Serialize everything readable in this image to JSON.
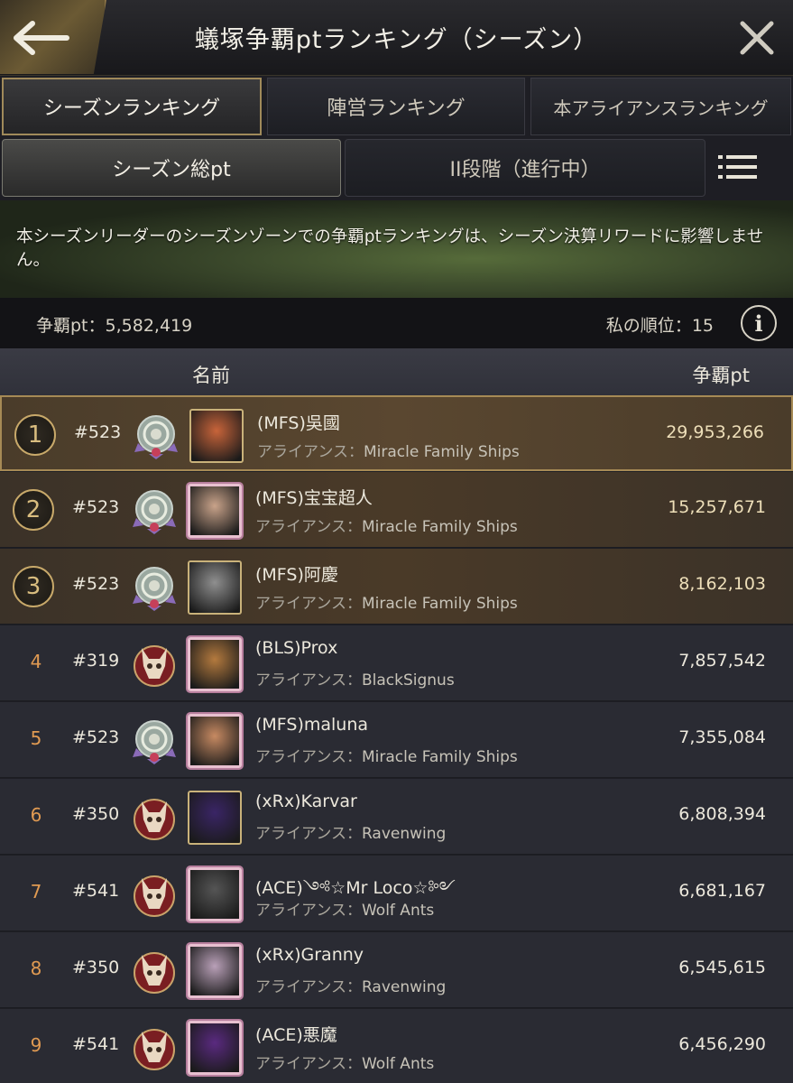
{
  "header": {
    "title": "蟻塚争覇ptランキング（シーズン）",
    "back_icon": "arrow-left-icon",
    "close_icon": "close-icon"
  },
  "tabs_primary": [
    {
      "label": "シーズンランキング",
      "active": true
    },
    {
      "label": "陣営ランキング",
      "active": false
    },
    {
      "label": "本アライアンスランキング",
      "active": false
    }
  ],
  "tabs_secondary": [
    {
      "label": "シーズン総pt",
      "active": true
    },
    {
      "label": "II段階（進行中）",
      "active": false
    }
  ],
  "menu_icon": "list-menu-icon",
  "banner": {
    "text": "本シーズンリーダーのシーズンゾーンでの争覇ptランキングは、シーズン決算リワードに影響しません。"
  },
  "stats": {
    "points_label": "争覇pt：",
    "points_value": "5,582,419",
    "rank_label": "私の順位：",
    "rank_value": "15"
  },
  "columns": {
    "name": "名前",
    "points": "争覇pt"
  },
  "alliance_label": "アライアンス：",
  "rows": [
    {
      "rank": "1",
      "server": "#523",
      "name": "(MFS)吳國",
      "alliance": "Miracle Family Ships",
      "points": "29,953,266",
      "emblem": "spiral-flower-emblem",
      "avatar_color": "#c8643a"
    },
    {
      "rank": "2",
      "server": "#523",
      "name": "(MFS)宝宝超人",
      "alliance": "Miracle Family Ships",
      "points": "15,257,671",
      "emblem": "spiral-flower-emblem",
      "avatar_color": "#c9a38a"
    },
    {
      "rank": "3",
      "server": "#523",
      "name": "(MFS)阿慶",
      "alliance": "Miracle Family Ships",
      "points": "8,162,103",
      "emblem": "spiral-flower-emblem",
      "avatar_color": "#8f8f8f"
    },
    {
      "rank": "4",
      "server": "#319",
      "name": "(BLS)Prox",
      "alliance": "BlackSignus",
      "points": "7,857,542",
      "emblem": "skull-emblem",
      "avatar_color": "#b47a3e"
    },
    {
      "rank": "5",
      "server": "#523",
      "name": "(MFS)maluna",
      "alliance": "Miracle Family Ships",
      "points": "7,355,084",
      "emblem": "spiral-flower-emblem",
      "avatar_color": "#c78a62"
    },
    {
      "rank": "6",
      "server": "#350",
      "name": "(xRx)Karvar",
      "alliance": "Ravenwing",
      "points": "6,808,394",
      "emblem": "skull-emblem",
      "avatar_color": "#3a2566"
    },
    {
      "rank": "7",
      "server": "#541",
      "name": "(ACE)༺☆Mr Loco☆༻",
      "alliance": "Wolf Ants",
      "points": "6,681,167",
      "emblem": "skull-emblem",
      "avatar_color": "#555555"
    },
    {
      "rank": "8",
      "server": "#350",
      "name": "(xRx)Granny",
      "alliance": "Ravenwing",
      "points": "6,545,615",
      "emblem": "skull-emblem",
      "avatar_color": "#b9a0b8"
    },
    {
      "rank": "9",
      "server": "#541",
      "name": "(ACE)悪魔",
      "alliance": "Wolf Ants",
      "points": "6,456,290",
      "emblem": "skull-emblem",
      "avatar_color": "#5a2a80"
    }
  ]
}
